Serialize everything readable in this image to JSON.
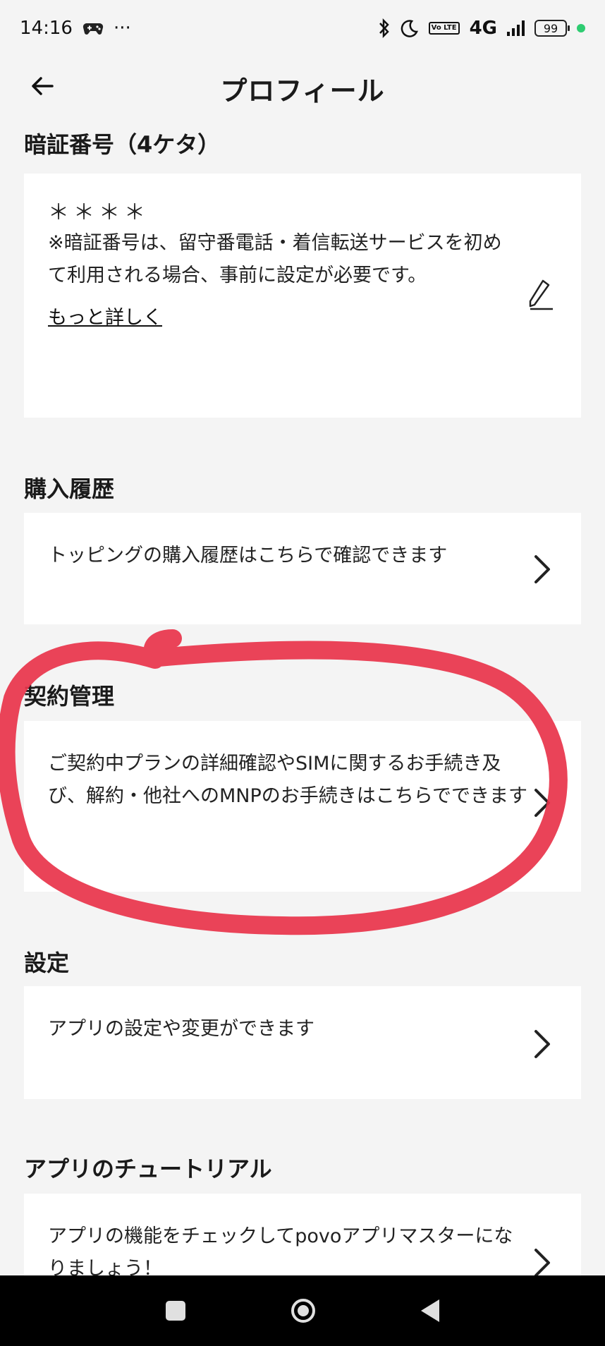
{
  "status_bar": {
    "time": "14:16",
    "dots": "···",
    "network": "4G",
    "lte_badge": "Vo LTE",
    "battery": "99"
  },
  "header": {
    "title": "プロフィール"
  },
  "sections": {
    "pin": {
      "title": "暗証番号（4ケタ）",
      "masked_value": "＊＊＊＊",
      "description": "※暗証番号は、留守番電話・着信転送サービスを初めて利用される場合、事前に設定が必要です。",
      "more_link": "もっと詳しく"
    },
    "purchase_history": {
      "title": "購入履歴",
      "description": "トッピングの購入履歴はこちらで確認できます"
    },
    "contract": {
      "title": "契約管理",
      "description": "ご契約中プランの詳細確認やSIMに関するお手続き及び、解約・他社へのMNPのお手続きはこちらでできます"
    },
    "settings": {
      "title": "設定",
      "description": "アプリの設定や変更ができます"
    },
    "tutorial": {
      "title": "アプリのチュートリアル",
      "description": "アプリの機能をチェックしてpovoアプリマスターになりましょう！"
    }
  },
  "colors": {
    "background": "#f4f4f4",
    "card": "#ffffff",
    "annotation_circle": "#e8334a"
  }
}
